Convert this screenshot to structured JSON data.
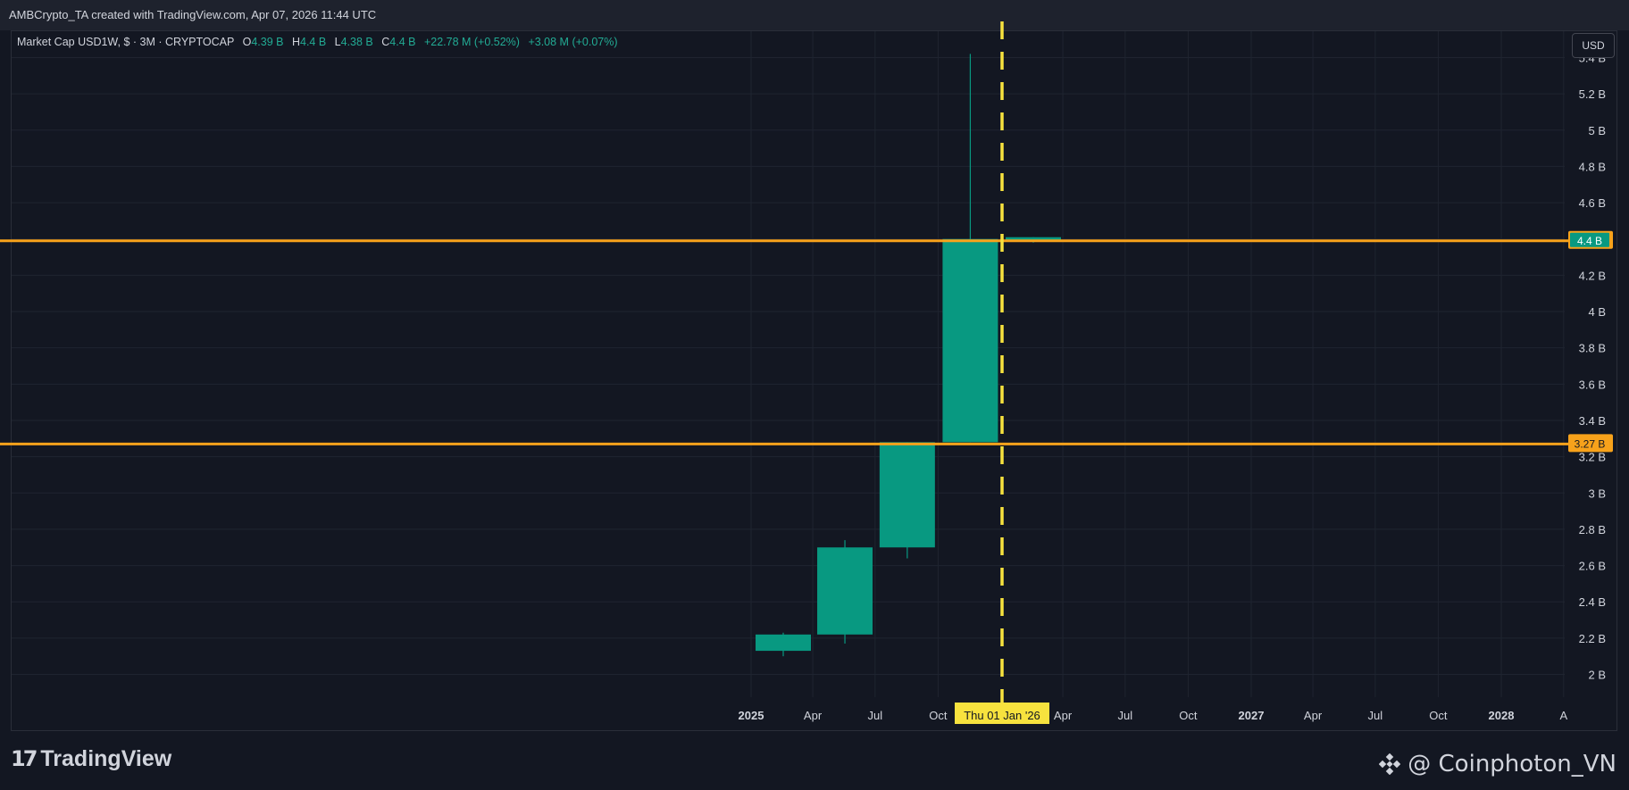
{
  "header": {
    "attribution": "AMBCrypto_TA created with TradingView.com, Apr 07, 2026 11:44 UTC"
  },
  "legend": {
    "symbol": "Market Cap USD1W, $ · 3M · CRYPTOCAP",
    "o_label": "O",
    "o_value": "4.39 B",
    "h_label": "H",
    "h_value": "4.4 B",
    "l_label": "L",
    "l_value": "4.38 B",
    "c_label": "C",
    "c_value": "4.4 B",
    "change": "+22.78 M (+0.52%)",
    "change2": "+3.08 M (+0.07%)"
  },
  "currency_button": "USD",
  "brand": {
    "name": "TradingView"
  },
  "watermark": {
    "text": "@ Coinphoton_VN"
  },
  "colors": {
    "background": "#131722",
    "grid": "#1f2430",
    "bull": "#089981",
    "level_line": "#f7a21b",
    "crosshair": "#f7e23e",
    "axis_text": "#d1d4dc"
  },
  "chart_data": {
    "type": "candlestick",
    "y_unit": "B",
    "ylim": [
      1.85,
      5.55
    ],
    "y_ticks": [
      {
        "value": 2.0,
        "label": "2 B"
      },
      {
        "value": 2.2,
        "label": "2.2 B"
      },
      {
        "value": 2.4,
        "label": "2.4 B"
      },
      {
        "value": 2.6,
        "label": "2.6 B"
      },
      {
        "value": 2.8,
        "label": "2.8 B"
      },
      {
        "value": 3.0,
        "label": "3 B"
      },
      {
        "value": 3.2,
        "label": "3.2 B"
      },
      {
        "value": 3.4,
        "label": "3.4 B"
      },
      {
        "value": 3.6,
        "label": "3.6 B"
      },
      {
        "value": 3.8,
        "label": "3.8 B"
      },
      {
        "value": 4.0,
        "label": "4 B"
      },
      {
        "value": 4.2,
        "label": "4.2 B"
      },
      {
        "value": 4.4,
        "label": "4.4 B"
      },
      {
        "value": 4.6,
        "label": "4.6 B"
      },
      {
        "value": 4.8,
        "label": "4.8 B"
      },
      {
        "value": 5.0,
        "label": "5 B"
      },
      {
        "value": 5.2,
        "label": "5.2 B"
      },
      {
        "value": 5.4,
        "label": "5.4 B"
      }
    ],
    "x_ticks": [
      {
        "date": "2025-01-01",
        "label": "2025",
        "bold": true
      },
      {
        "date": "2025-04-01",
        "label": "Apr",
        "bold": false
      },
      {
        "date": "2025-07-01",
        "label": "Jul",
        "bold": false
      },
      {
        "date": "2025-10-01",
        "label": "Oct",
        "bold": false
      },
      {
        "date": "2026-04-01",
        "label": "Apr",
        "bold": false
      },
      {
        "date": "2026-07-01",
        "label": "Jul",
        "bold": false
      },
      {
        "date": "2026-10-01",
        "label": "Oct",
        "bold": false
      },
      {
        "date": "2027-01-01",
        "label": "2027",
        "bold": true
      },
      {
        "date": "2027-04-01",
        "label": "Apr",
        "bold": false
      },
      {
        "date": "2027-07-01",
        "label": "Jul",
        "bold": false
      },
      {
        "date": "2027-10-01",
        "label": "Oct",
        "bold": false
      },
      {
        "date": "2028-01-01",
        "label": "2028",
        "bold": true
      },
      {
        "date": "2028-04-01",
        "label": "A",
        "bold": false
      }
    ],
    "candles": [
      {
        "date": "2025-01-01",
        "open": 2.13,
        "high": 2.23,
        "low": 2.1,
        "close": 2.22
      },
      {
        "date": "2025-04-01",
        "open": 2.22,
        "high": 2.74,
        "low": 2.17,
        "close": 2.7
      },
      {
        "date": "2025-07-01",
        "open": 2.7,
        "high": 3.28,
        "low": 2.64,
        "close": 3.28
      },
      {
        "date": "2025-10-01",
        "open": 3.28,
        "high": 5.42,
        "low": 3.28,
        "close": 4.4
      },
      {
        "date": "2026-01-01",
        "open": 4.39,
        "high": 4.41,
        "low": 4.38,
        "close": 4.41
      }
    ],
    "horizontal_levels": [
      {
        "value": 4.39,
        "label": "4.4 B"
      },
      {
        "value": 3.27,
        "label": "3.27 B"
      }
    ],
    "crosshair": {
      "date": "2026-01-01",
      "label": "Thu 01 Jan '26"
    },
    "grid": true
  }
}
